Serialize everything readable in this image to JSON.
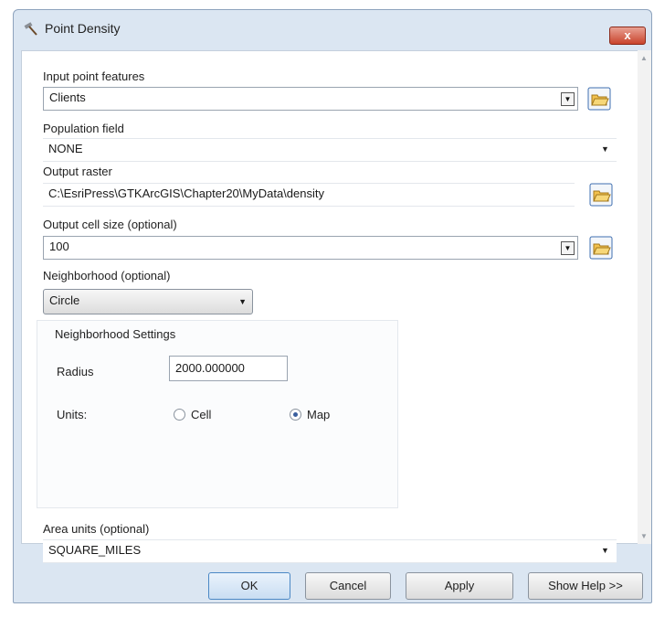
{
  "window": {
    "title": "Point Density",
    "close_label": "x"
  },
  "fields": {
    "input_point_features": {
      "label": "Input point features",
      "value": "Clients"
    },
    "population_field": {
      "label": "Population field",
      "value": "NONE"
    },
    "output_raster": {
      "label": "Output raster",
      "value": "C:\\EsriPress\\GTKArcGIS\\Chapter20\\MyData\\density"
    },
    "output_cell_size": {
      "label": "Output cell size (optional)",
      "value": "100"
    },
    "neighborhood": {
      "label": "Neighborhood (optional)",
      "value": "Circle"
    },
    "neighborhood_settings": {
      "title": "Neighborhood Settings",
      "radius_label": "Radius",
      "radius_value": "2000.000000",
      "units_label": "Units:",
      "units_options": [
        "Cell",
        "Map"
      ],
      "units_selected": "Map"
    },
    "area_units": {
      "label": "Area units (optional)",
      "value": "SQUARE_MILES"
    }
  },
  "buttons": {
    "ok": "OK",
    "cancel": "Cancel",
    "apply": "Apply",
    "show_help": "Show Help >>"
  },
  "icons": {
    "title": "hammer-icon",
    "browse": "folder-open-icon"
  }
}
